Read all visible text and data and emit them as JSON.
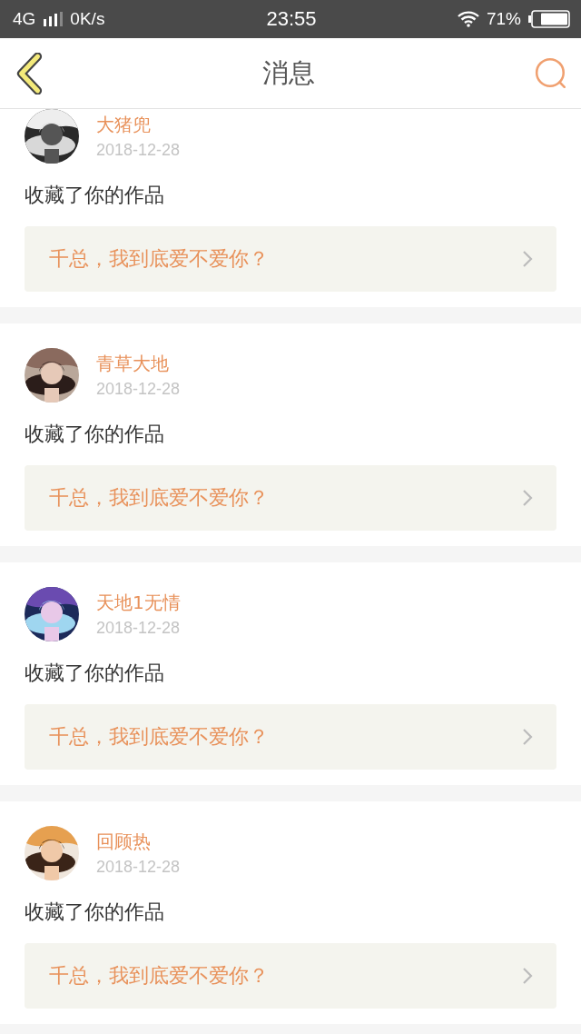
{
  "status_bar": {
    "network": "4G",
    "speed": "0K/s",
    "time": "23:55",
    "battery": "71%"
  },
  "header": {
    "title": "消息"
  },
  "messages": [
    {
      "name": "大猪兜",
      "date": "2018-12-28",
      "action": "收藏了你的作品",
      "work": "千总，我到底爱不爱你？"
    },
    {
      "name": "青草大地",
      "date": "2018-12-28",
      "action": "收藏了你的作品",
      "work": "千总，我到底爱不爱你？"
    },
    {
      "name": "天地1无情",
      "date": "2018-12-28",
      "action": "收藏了你的作品",
      "work": "千总，我到底爱不爱你？"
    },
    {
      "name": "回顾热",
      "date": "2018-12-28",
      "action": "收藏了你的作品",
      "work": "千总，我到底爱不爱你？"
    }
  ]
}
